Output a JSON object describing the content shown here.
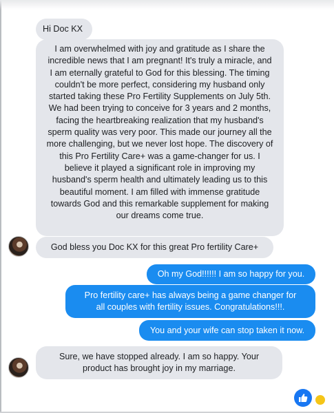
{
  "messages": [
    {
      "from": "them",
      "text": "Hi Doc KX"
    },
    {
      "from": "them",
      "text": "I am overwhelmed with joy and gratitude as I share the incredible news that I am pregnant! It's truly a miracle, and I am eternally grateful to God for this blessing. The timing couldn't be more perfect, considering my husband only started taking these Pro Fertility Supplements on July 5th. We had been trying to conceive for 3 years and 2 months, facing the heartbreaking realization that my husband's sperm quality was very poor. This made our journey all the more challenging, but we never lost hope. The discovery of this Pro Fertility Care+ was a game-changer for us. I believe it played a significant role in improving my husband's sperm health and ultimately leading us to this beautiful moment. I am filled with immense gratitude towards God and this remarkable supplement for making our dreams come true."
    },
    {
      "from": "them",
      "text": "God bless you Doc KX for this great Pro fertility Care+"
    },
    {
      "from": "me",
      "text": "Oh my God!!!!!! I am so happy for you."
    },
    {
      "from": "me",
      "text": "Pro fertility care+ has always being a game changer for all couples with fertility issues. Congratulations!!!."
    },
    {
      "from": "me",
      "text": "You and your wife can stop taken it now."
    },
    {
      "from": "them",
      "text": "Sure, we have stopped already. I am so happy. Your product has brought joy in my marriage."
    }
  ],
  "icons": {
    "avatar": "contact-avatar",
    "like": "thumbs-up-icon",
    "seen": "seen-indicator"
  },
  "colors": {
    "received_bubble": "#e4e6eb",
    "sent_bubble": "#1a8cf0",
    "like_button": "#1877f2"
  }
}
